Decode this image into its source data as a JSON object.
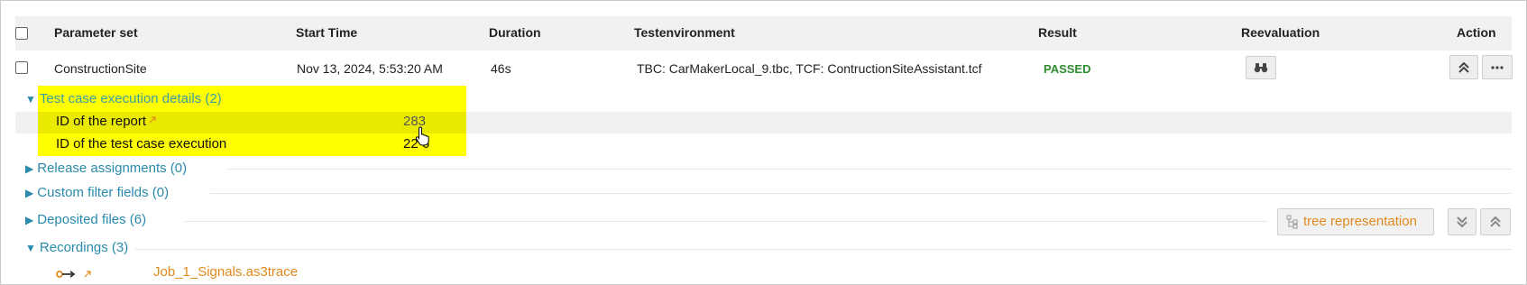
{
  "header": {
    "parameter_set": "Parameter set",
    "start_time": "Start Time",
    "duration": "Duration",
    "testenvironment": "Testenvironment",
    "result": "Result",
    "reevaluation": "Reevaluation",
    "action": "Action"
  },
  "row": {
    "parameter_set": "ConstructionSite",
    "start_time": "Nov 13, 2024, 5:53:20 AM",
    "duration": "46s",
    "testenvironment": "TBC: CarMakerLocal_9.tbc, TCF: ContructionSiteAssistant.tcf",
    "result": "PASSED",
    "result_color": "#2e8b2e"
  },
  "details": {
    "title": "Test case execution details (2)",
    "report_label": "ID of the report",
    "report_value": "283",
    "execution_label": "ID of the test case execution",
    "execution_value": "22  6"
  },
  "sections": {
    "release_assignments": "Release assignments (0)",
    "custom_filter_fields": "Custom filter fields (0)",
    "deposited_files": "Deposited files (6)",
    "recordings": "Recordings (3)"
  },
  "tree_button": {
    "label": "tree representation"
  },
  "recording": {
    "file": "Job_1_Signals.as3trace"
  },
  "colors": {
    "accent_link": "#2a8aab",
    "orange_link": "#e08a1e",
    "highlight": "#ffff00"
  },
  "icons": {
    "reevaluation": "binoculars-icon",
    "collapse": "double-chevron-up-icon",
    "more": "ellipsis-icon",
    "expand_all": "double-chevron-down-icon",
    "collapse_all": "double-chevron-up-icon",
    "tree": "tree-icon",
    "signal": "signal-key-icon",
    "external": "external-link-icon"
  }
}
